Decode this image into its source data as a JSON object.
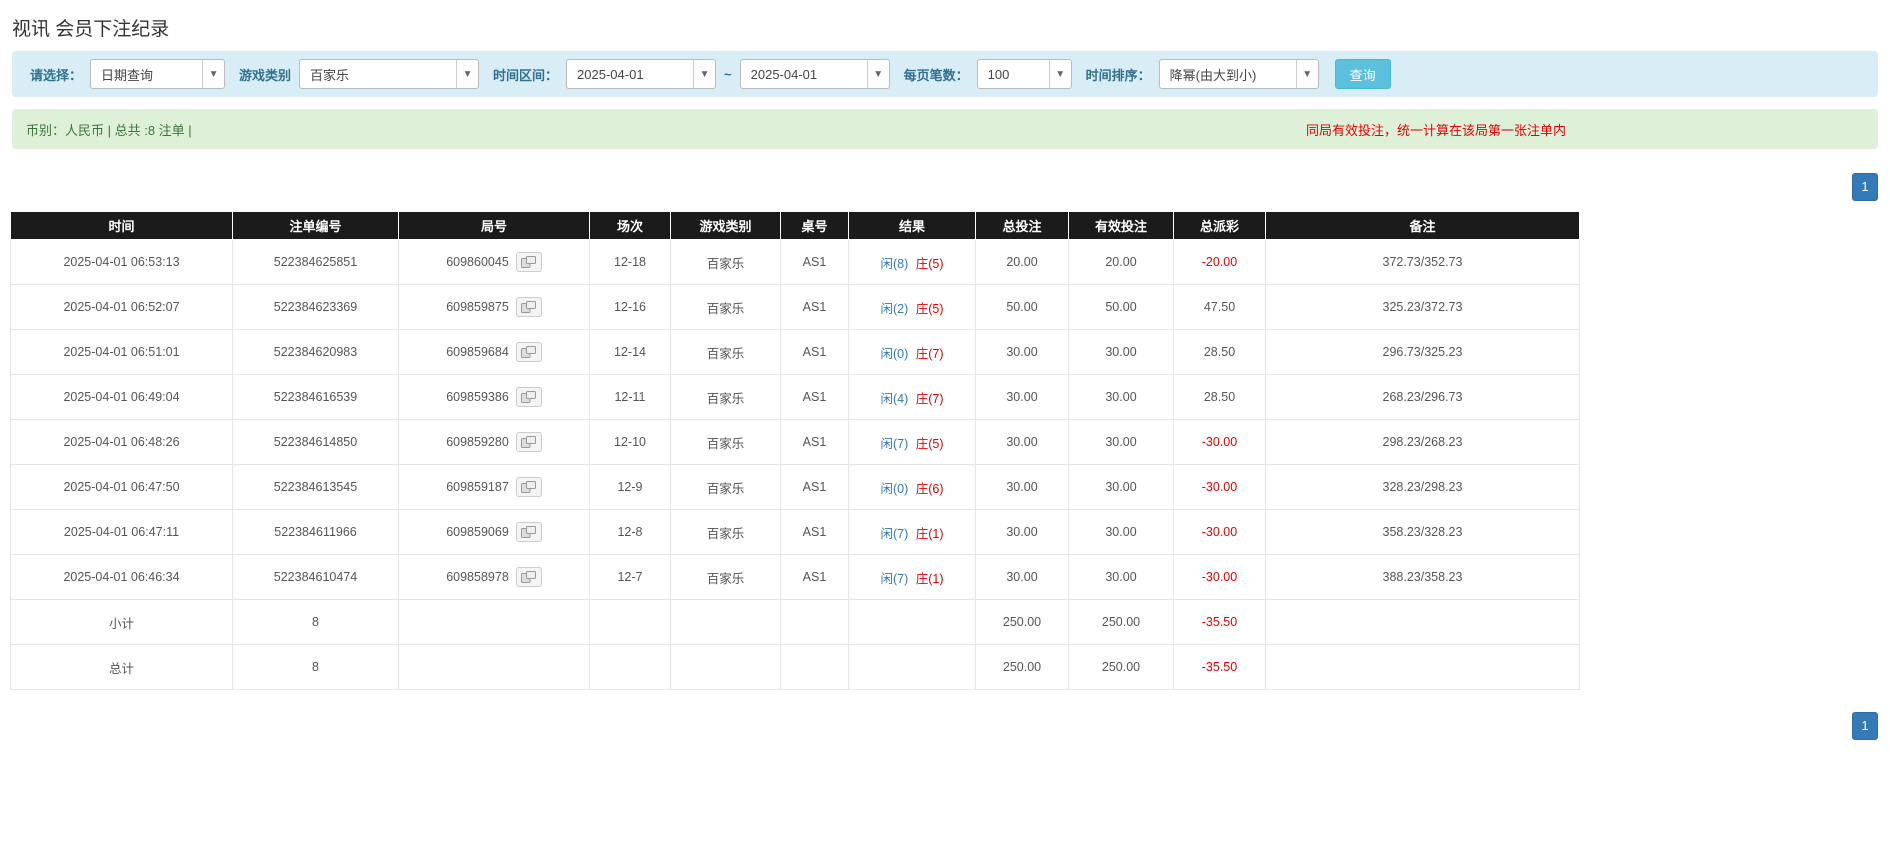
{
  "page": {
    "title": "视讯 会员下注纪录"
  },
  "colors": {
    "filter_bar_bg": "#d9edf7",
    "info_bar_bg": "#dff0d8",
    "info_text_green": "#3c763d",
    "notice_red": "#e60000",
    "link_blue": "#337ab7",
    "table_header_bg": "#1b1b1b",
    "table_footer_bg": "#9e9e9e",
    "query_button_bg": "#5bc0de"
  },
  "filters": {
    "select_label": "请选择：",
    "select_value": "日期查询",
    "game_type_label": "游戏类别",
    "game_type_value": "百家乐",
    "time_range_label": "时间区间：",
    "date_from": "2025-04-01",
    "date_separator": "~",
    "date_to": "2025-04-01",
    "page_size_label": "每页笔数：",
    "page_size_value": "100",
    "sort_label": "时间排序：",
    "sort_value": "降幂(由大到小)",
    "query_button": "查询"
  },
  "info_bar": {
    "left": "币别：人民币 | 总共 :8 注单 |",
    "right": "同局有效投注，统一计算在该局第一张注单内"
  },
  "pagination": {
    "current_page": "1"
  },
  "table": {
    "headers": [
      "时间",
      "注单编号",
      "局号",
      "场次",
      "游戏类别",
      "桌号",
      "结果",
      "总投注",
      "有效投注",
      "总派彩",
      "备注"
    ],
    "rows": [
      {
        "time": "2025-04-01 06:53:13",
        "bet_id": "522384625851",
        "round_id": "609860045",
        "session": "12-18",
        "game": "百家乐",
        "table_no": "AS1",
        "result_player": "闲(8)",
        "result_banker": "庄(5)",
        "total_bet": "20.00",
        "valid_bet": "20.00",
        "payout": "-20.00",
        "remark": "372.73/352.73"
      },
      {
        "time": "2025-04-01 06:52:07",
        "bet_id": "522384623369",
        "round_id": "609859875",
        "session": "12-16",
        "game": "百家乐",
        "table_no": "AS1",
        "result_player": "闲(2)",
        "result_banker": "庄(5)",
        "total_bet": "50.00",
        "valid_bet": "50.00",
        "payout": "47.50",
        "remark": "325.23/372.73"
      },
      {
        "time": "2025-04-01 06:51:01",
        "bet_id": "522384620983",
        "round_id": "609859684",
        "session": "12-14",
        "game": "百家乐",
        "table_no": "AS1",
        "result_player": "闲(0)",
        "result_banker": "庄(7)",
        "total_bet": "30.00",
        "valid_bet": "30.00",
        "payout": "28.50",
        "remark": "296.73/325.23"
      },
      {
        "time": "2025-04-01 06:49:04",
        "bet_id": "522384616539",
        "round_id": "609859386",
        "session": "12-11",
        "game": "百家乐",
        "table_no": "AS1",
        "result_player": "闲(4)",
        "result_banker": "庄(7)",
        "total_bet": "30.00",
        "valid_bet": "30.00",
        "payout": "28.50",
        "remark": "268.23/296.73"
      },
      {
        "time": "2025-04-01 06:48:26",
        "bet_id": "522384614850",
        "round_id": "609859280",
        "session": "12-10",
        "game": "百家乐",
        "table_no": "AS1",
        "result_player": "闲(7)",
        "result_banker": "庄(5)",
        "total_bet": "30.00",
        "valid_bet": "30.00",
        "payout": "-30.00",
        "remark": "298.23/268.23"
      },
      {
        "time": "2025-04-01 06:47:50",
        "bet_id": "522384613545",
        "round_id": "609859187",
        "session": "12-9",
        "game": "百家乐",
        "table_no": "AS1",
        "result_player": "闲(0)",
        "result_banker": "庄(6)",
        "total_bet": "30.00",
        "valid_bet": "30.00",
        "payout": "-30.00",
        "remark": "328.23/298.23"
      },
      {
        "time": "2025-04-01 06:47:11",
        "bet_id": "522384611966",
        "round_id": "609859069",
        "session": "12-8",
        "game": "百家乐",
        "table_no": "AS1",
        "result_player": "闲(7)",
        "result_banker": "庄(1)",
        "total_bet": "30.00",
        "valid_bet": "30.00",
        "payout": "-30.00",
        "remark": "358.23/328.23"
      },
      {
        "time": "2025-04-01 06:46:34",
        "bet_id": "522384610474",
        "round_id": "609858978",
        "session": "12-7",
        "game": "百家乐",
        "table_no": "AS1",
        "result_player": "闲(7)",
        "result_banker": "庄(1)",
        "total_bet": "30.00",
        "valid_bet": "30.00",
        "payout": "-30.00",
        "remark": "388.23/358.23"
      }
    ],
    "subtotal": {
      "label": "小计",
      "count": "8",
      "total_bet": "250.00",
      "valid_bet": "250.00",
      "payout": "-35.50"
    },
    "total": {
      "label": "总计",
      "count": "8",
      "total_bet": "250.00",
      "valid_bet": "250.00",
      "payout": "-35.50"
    }
  }
}
